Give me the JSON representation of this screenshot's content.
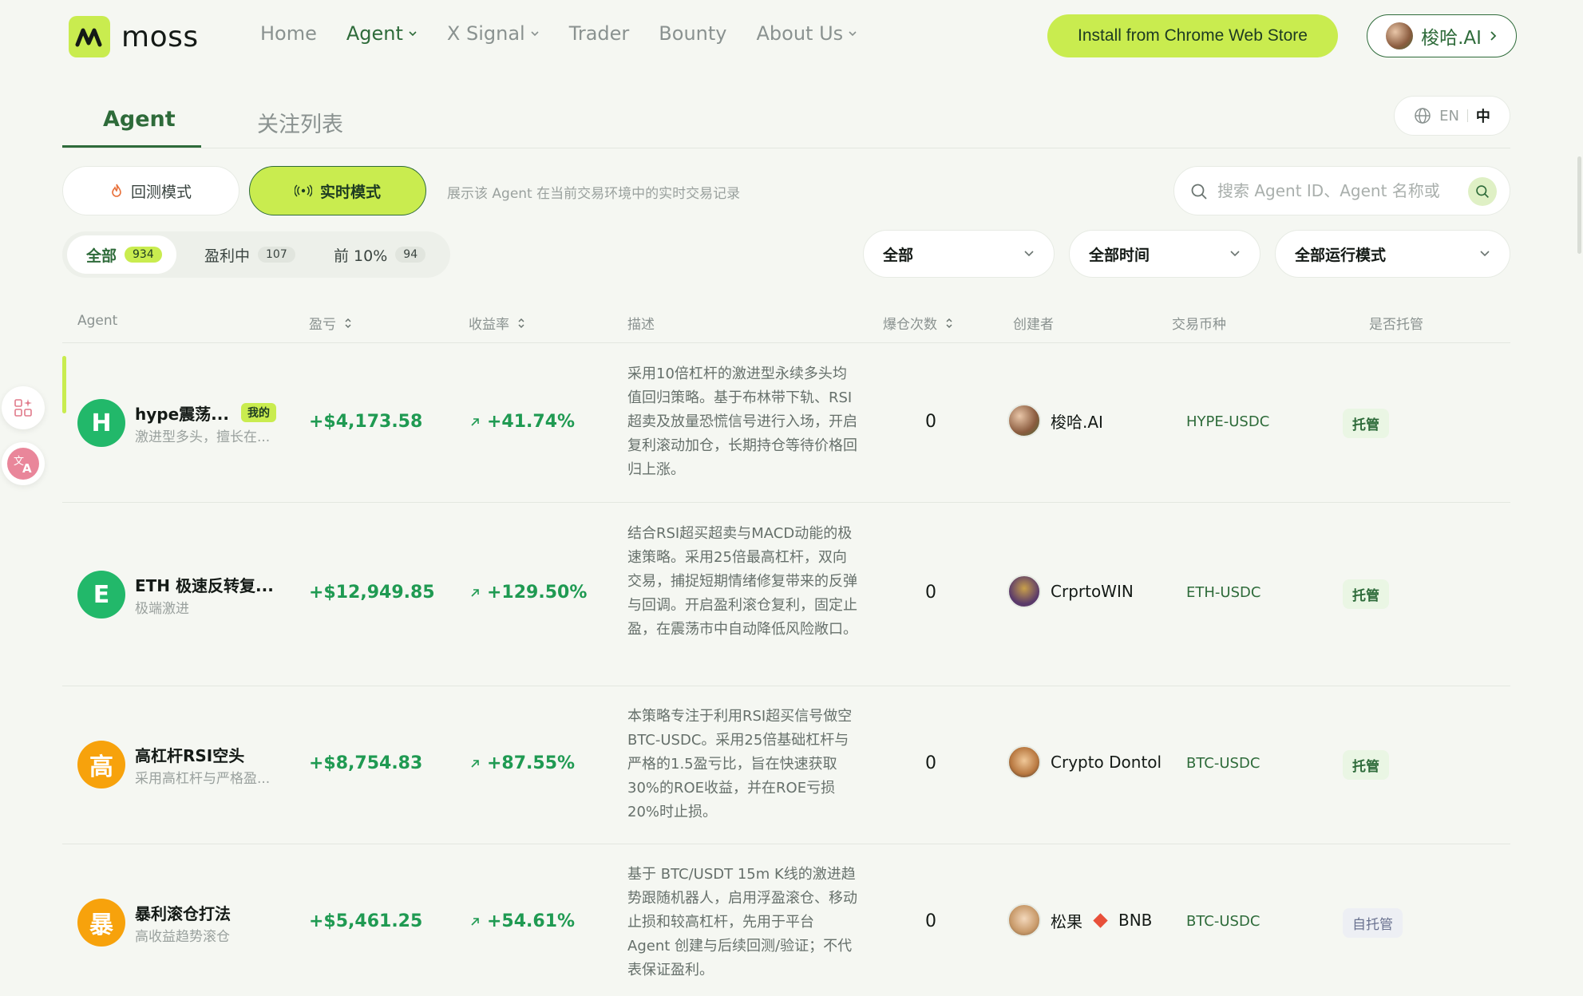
{
  "brand": {
    "name": "moss",
    "accent": "#c9ec4f",
    "primary": "#2e6b3a",
    "positive": "#1f9a52"
  },
  "nav": {
    "home": "Home",
    "agent": "Agent",
    "x_signal": "X Signal",
    "trader": "Trader",
    "bounty": "Bounty",
    "about": "About Us"
  },
  "header": {
    "install_label": "Install from Chrome Web Store",
    "user_name": "梭哈.AI"
  },
  "tabs": {
    "agent": "Agent",
    "watchlist": "关注列表"
  },
  "lang": {
    "en": "EN",
    "zh": "中"
  },
  "modes": {
    "backtest": "回测模式",
    "live": "实时模式",
    "live_desc": "展示该 Agent 在当前交易环境中的实时交易记录"
  },
  "search": {
    "placeholder": "搜索 Agent ID、Agent 名称或"
  },
  "filters": {
    "all": {
      "label": "全部",
      "count": "934"
    },
    "profit": {
      "label": "盈利中",
      "count": "107"
    },
    "top10": {
      "label": "前 10%",
      "count": "94"
    }
  },
  "selects": {
    "category": "全部",
    "time": "全部时间",
    "run_mode": "全部运行模式"
  },
  "table": {
    "headers": {
      "agent": "Agent",
      "pnl": "盈亏",
      "return": "收益率",
      "desc": "描述",
      "liquidations": "爆仓次数",
      "creator": "创建者",
      "pair": "交易币种",
      "custody": "是否托管"
    },
    "mine_badge": "我的",
    "rows": [
      {
        "initial": "H",
        "name": "hype震荡...",
        "subtitle": "激进型多头，擅长在...",
        "pnl": "+$4,173.58",
        "return": "+41.74%",
        "desc": "采用10倍杠杆的激进型永续多头均值回归策略。基于布林带下轨、RSI超卖及放量恐慌信号进行入场，开启复利滚动加仓，长期持仓等待价格回归上涨。",
        "liquidations": "0",
        "creator": "梭哈.AI",
        "pair": "HYPE-USDC",
        "custody": "托管"
      },
      {
        "initial": "E",
        "name": "ETH 极速反转复...",
        "subtitle": "极端激进",
        "pnl": "+$12,949.85",
        "return": "+129.50%",
        "desc": "结合RSI超买超卖与MACD动能的极速策略。采用25倍最高杠杆，双向交易，捕捉短期情绪修复带来的反弹与回调。开启盈利滚仓复利，固定止盈，在震荡市中自动降低风险敞口。",
        "liquidations": "0",
        "creator": "CrprtoWIN",
        "pair": "ETH-USDC",
        "custody": "托管"
      },
      {
        "initial": "高",
        "name": "高杠杆RSI空头",
        "subtitle": "采用高杠杆与严格盈...",
        "pnl": "+$8,754.83",
        "return": "+87.55%",
        "desc": "本策略专注于利用RSI超买信号做空BTC-USDC。采用25倍基础杠杆与严格的1.5盈亏比，旨在快速获取30%的ROE收益，并在ROE亏损20%时止损。",
        "liquidations": "0",
        "creator": "Crypto Dontol",
        "pair": "BTC-USDC",
        "custody": "托管"
      },
      {
        "initial": "暴",
        "name": "暴利滚仓打法",
        "subtitle": "高收益趋势滚仓",
        "pnl": "+$5,461.25",
        "return": "+54.61%",
        "desc": "基于 BTC/USDT 15m K线的激进趋势跟随机器人，启用浮盈滚仓、移动止损和较高杠杆，先用于平台 Agent 创建与后续回测/验证；不代表保证盈利。",
        "liquidations": "0",
        "creator": "松果",
        "creator_suffix": "BNB",
        "pair": "BTC-USDC",
        "custody": "自托管"
      }
    ]
  },
  "icons": {
    "logo": "moss-logo-icon",
    "chevron": "chevron-down-icon",
    "globe": "globe-icon",
    "flame": "flame-icon",
    "broadcast": "broadcast-icon",
    "search": "search-icon",
    "sort": "sort-icon",
    "trend": "trend-up-icon",
    "apps": "apps-sparkle-icon",
    "translate": "translate-icon"
  }
}
